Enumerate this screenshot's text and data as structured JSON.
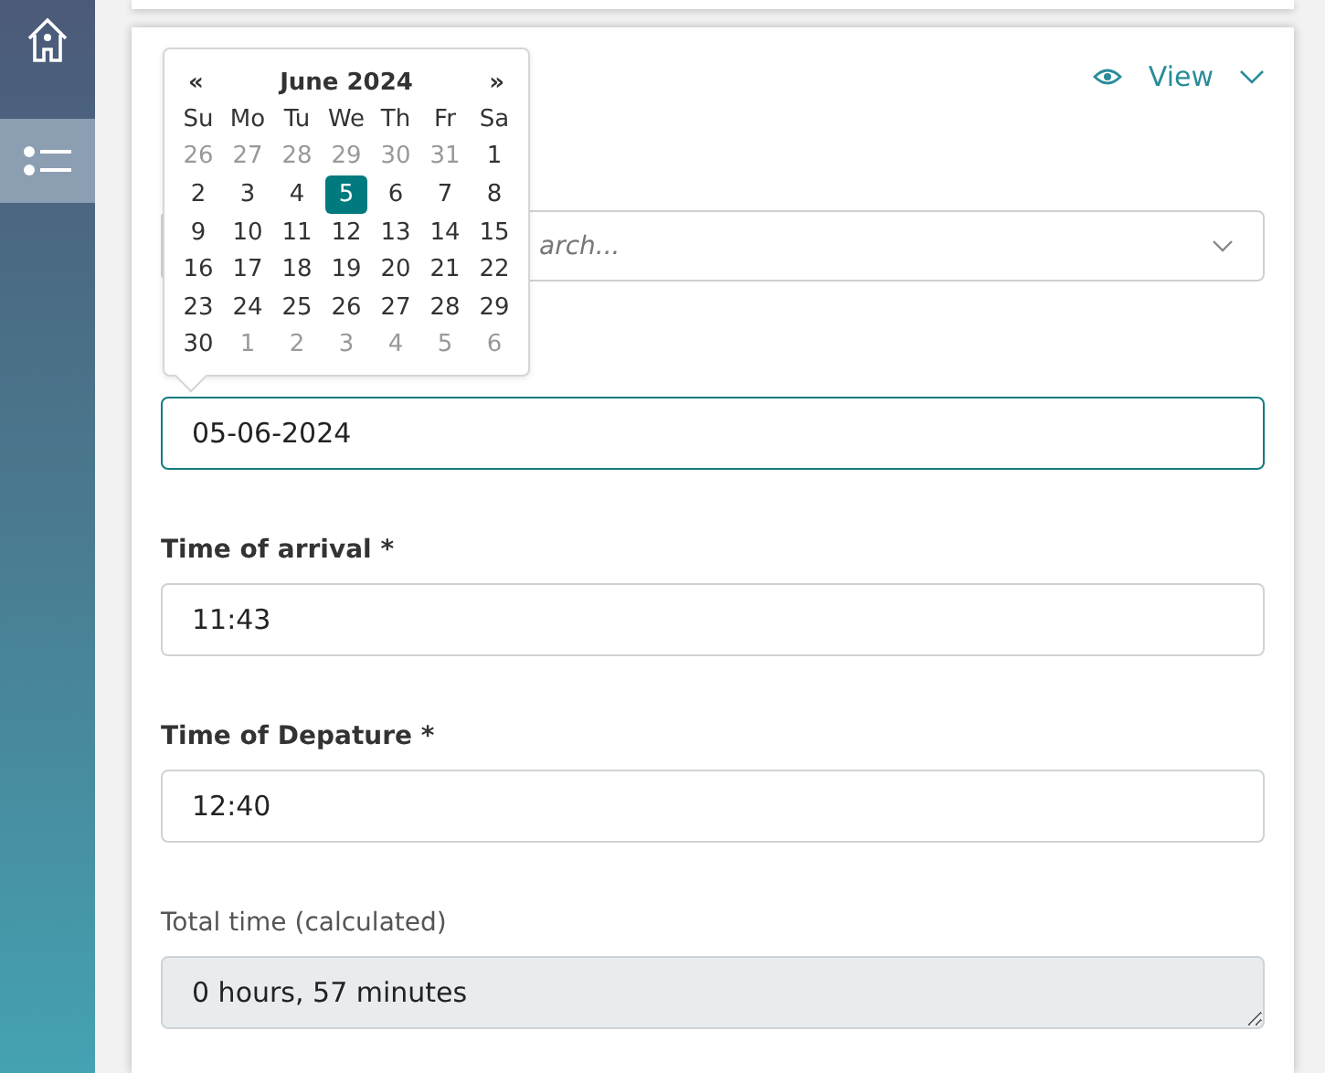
{
  "sidebar": {
    "items": [
      {
        "kind": "home",
        "selected": false
      },
      {
        "kind": "list",
        "selected": true
      }
    ]
  },
  "header": {
    "view_label": "View"
  },
  "search_dropdown": {
    "placeholder": "arch..."
  },
  "calendar": {
    "prev": "«",
    "title": "June 2024",
    "next": "»",
    "weekdays": [
      "Su",
      "Mo",
      "Tu",
      "We",
      "Th",
      "Fr",
      "Sa"
    ],
    "days": [
      {
        "label": "26",
        "outside": true,
        "selected": false
      },
      {
        "label": "27",
        "outside": true,
        "selected": false
      },
      {
        "label": "28",
        "outside": true,
        "selected": false
      },
      {
        "label": "29",
        "outside": true,
        "selected": false
      },
      {
        "label": "30",
        "outside": true,
        "selected": false
      },
      {
        "label": "31",
        "outside": true,
        "selected": false
      },
      {
        "label": "1",
        "outside": false,
        "selected": false
      },
      {
        "label": "2",
        "outside": false,
        "selected": false
      },
      {
        "label": "3",
        "outside": false,
        "selected": false
      },
      {
        "label": "4",
        "outside": false,
        "selected": false
      },
      {
        "label": "5",
        "outside": false,
        "selected": true
      },
      {
        "label": "6",
        "outside": false,
        "selected": false
      },
      {
        "label": "7",
        "outside": false,
        "selected": false
      },
      {
        "label": "8",
        "outside": false,
        "selected": false
      },
      {
        "label": "9",
        "outside": false,
        "selected": false
      },
      {
        "label": "10",
        "outside": false,
        "selected": false
      },
      {
        "label": "11",
        "outside": false,
        "selected": false
      },
      {
        "label": "12",
        "outside": false,
        "selected": false
      },
      {
        "label": "13",
        "outside": false,
        "selected": false
      },
      {
        "label": "14",
        "outside": false,
        "selected": false
      },
      {
        "label": "15",
        "outside": false,
        "selected": false
      },
      {
        "label": "16",
        "outside": false,
        "selected": false
      },
      {
        "label": "17",
        "outside": false,
        "selected": false
      },
      {
        "label": "18",
        "outside": false,
        "selected": false
      },
      {
        "label": "19",
        "outside": false,
        "selected": false
      },
      {
        "label": "20",
        "outside": false,
        "selected": false
      },
      {
        "label": "21",
        "outside": false,
        "selected": false
      },
      {
        "label": "22",
        "outside": false,
        "selected": false
      },
      {
        "label": "23",
        "outside": false,
        "selected": false
      },
      {
        "label": "24",
        "outside": false,
        "selected": false
      },
      {
        "label": "25",
        "outside": false,
        "selected": false
      },
      {
        "label": "26",
        "outside": false,
        "selected": false
      },
      {
        "label": "27",
        "outside": false,
        "selected": false
      },
      {
        "label": "28",
        "outside": false,
        "selected": false
      },
      {
        "label": "29",
        "outside": false,
        "selected": false
      },
      {
        "label": "30",
        "outside": false,
        "selected": false
      },
      {
        "label": "1",
        "outside": true,
        "selected": false
      },
      {
        "label": "2",
        "outside": true,
        "selected": false
      },
      {
        "label": "3",
        "outside": true,
        "selected": false
      },
      {
        "label": "4",
        "outside": true,
        "selected": false
      },
      {
        "label": "5",
        "outside": true,
        "selected": false
      },
      {
        "label": "6",
        "outside": true,
        "selected": false
      }
    ]
  },
  "fields": [
    {
      "kind": "date",
      "value": "05-06-2024",
      "focused": true,
      "readonly": false
    },
    {
      "kind": "time",
      "label": "Time of arrival *",
      "value": "11:43",
      "focused": false,
      "readonly": false
    },
    {
      "kind": "time",
      "label": "Time of Depature *",
      "value": "12:40",
      "focused": false,
      "readonly": false
    },
    {
      "kind": "calculated",
      "label": "Total time (calculated)",
      "value": "0 hours, 57 minutes",
      "focused": false,
      "readonly": true
    }
  ]
}
